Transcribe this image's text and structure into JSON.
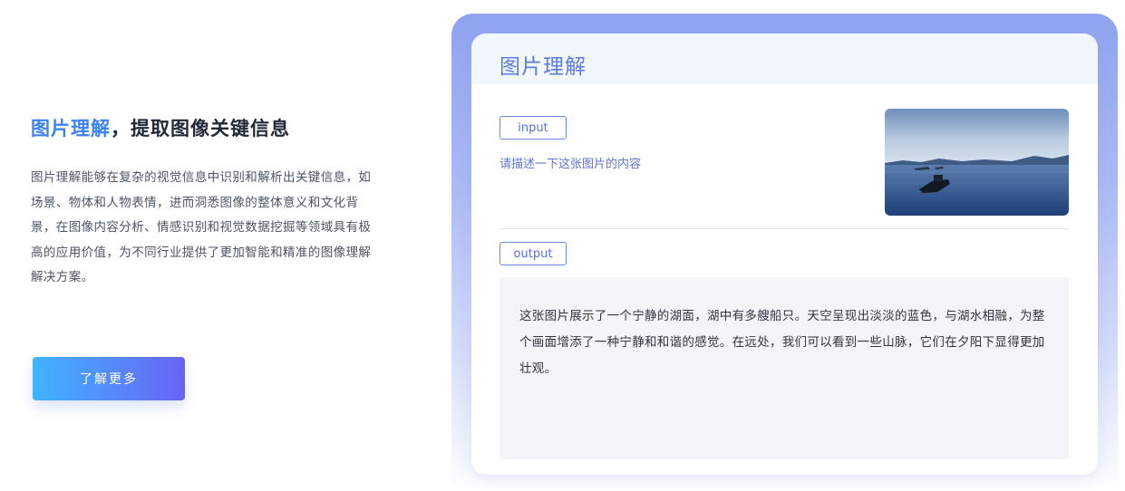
{
  "intro": {
    "title_accent": "图片理解",
    "title_rest": "，提取图像关键信息",
    "description": "图片理解能够在复杂的视觉信息中识别和解析出关键信息，如场景、物体和人物表情，进而洞悉图像的整体意义和文化背景，在图像内容分析、情感识别和视觉数据挖掘等领域具有极高的应用价值，为不同行业提供了更加智能和精准的图像理解解决方案。",
    "button_label": "了解更多"
  },
  "demo": {
    "title": "图片理解",
    "input_tag": "input",
    "prompt": "请描述一下这张图片的内容",
    "output_tag": "output",
    "output_text": "这张图片展示了一个宁静的湖面，湖中有多艘船只。天空呈现出淡淡的蓝色，与湖水相融，为整个画面增添了一种宁静和和谐的感觉。在远处，我们可以看到一些山脉，它们在夕阳下显得更加壮观。"
  },
  "colors": {
    "accent": "#3b82f6",
    "demo_title": "#5b7ce0",
    "button_gradient_start": "#3fb4ff",
    "button_gradient_end": "#6a63f6"
  }
}
